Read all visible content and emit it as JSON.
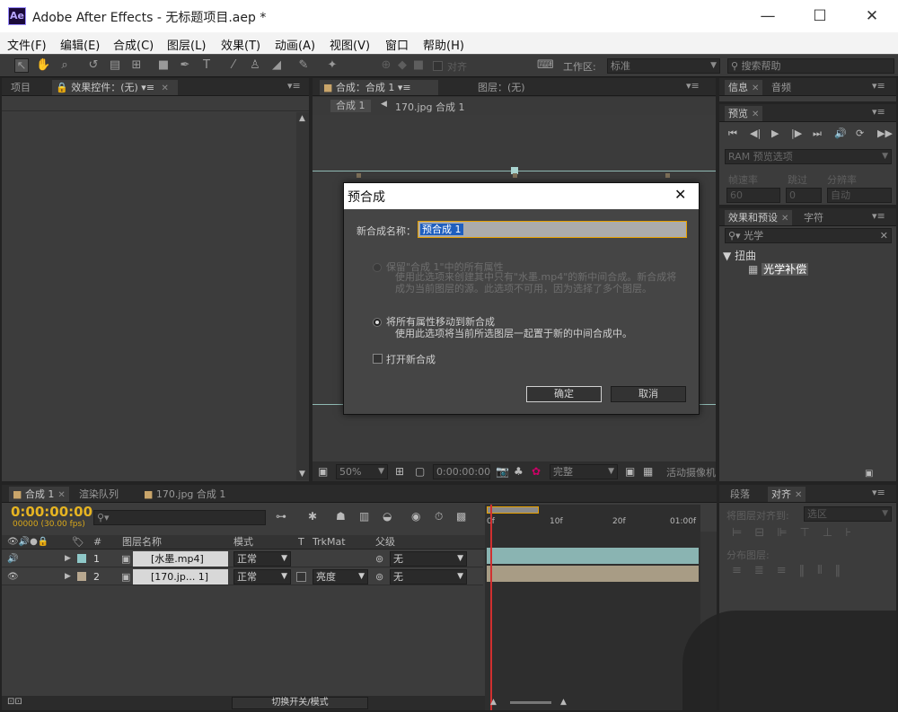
{
  "window": {
    "app_icon": "Ae",
    "title": "Adobe After Effects - 无标题项目.aep *",
    "minimize": "—",
    "maximize": "☐",
    "close": "✕"
  },
  "menu": [
    "文件(F)",
    "编辑(E)",
    "合成(C)",
    "图层(L)",
    "效果(T)",
    "动画(A)",
    "视图(V)",
    "窗口",
    "帮助(H)"
  ],
  "toolbar": {
    "align_label": "对齐",
    "workspace_label": "工作区:",
    "workspace_value": "标准",
    "search_placeholder": "搜索帮助"
  },
  "project_panel": {
    "tab_project": "项目",
    "tab_effect_controls": "效果控件：(无)"
  },
  "comp_panel": {
    "tab_comp": "合成：合成 1",
    "tab_layer": "图层：(无)",
    "breadcrumb_comp": "合成 1",
    "breadcrumb_item": "170.jpg 合成 1",
    "zoom": "50%",
    "timecode": "0:00:00:00",
    "resolution": "完整",
    "active_camera": "活动摄像机"
  },
  "info_panel": {
    "tab_info": "信息",
    "tab_audio": "音频"
  },
  "preview_panel": {
    "tab": "预览",
    "ram_options": "RAM 预览选项",
    "frame_rate_label": "帧速率",
    "skip_label": "跳过",
    "resolution_label": "分辨率",
    "frame_rate_value": "60",
    "skip_value": "0",
    "resolution_value": "自动"
  },
  "effects_panel": {
    "tab_effects": "效果和预设",
    "tab_char": "字符",
    "search_value": "光学",
    "category": "扭曲",
    "effect": "光学补偿"
  },
  "timeline": {
    "tab_comp": "合成 1",
    "tab_render": "渲染队列",
    "tab_jpg": "170.jpg 合成 1",
    "timecode": "0:00:00:00",
    "fps": "00000 (30.00 fps)",
    "col_num": "#",
    "col_name": "图层名称",
    "col_mode": "模式",
    "col_t": "T",
    "col_trkmat": "TrkMat",
    "col_parent": "父级",
    "ruler": [
      "0f",
      "10f",
      "20f",
      "01:00f"
    ],
    "layers": [
      {
        "num": "1",
        "name": "[水墨.mp4]",
        "mode": "正常",
        "trkmat": "",
        "parent": "无",
        "color": "#8fc8c8"
      },
      {
        "num": "2",
        "name": "[170.jp... 1]",
        "mode": "正常",
        "trkmat": "亮度",
        "parent": "无",
        "color": "#b8a890"
      }
    ],
    "toggle_switch": "切换开关/模式"
  },
  "align_panel": {
    "tab_paragraph": "段落",
    "tab_align": "对齐",
    "align_to_label": "将图层对齐到:",
    "align_to_value": "选区",
    "distribute_label": "分布图层:"
  },
  "dialog": {
    "title": "预合成",
    "name_label": "新合成名称：",
    "name_value": "预合成 1",
    "option1_title": "保留\"合成 1\"中的所有属性",
    "option1_desc": "使用此选项来创建其中只有\"水墨.mp4\"的新中间合成。新合成将成为当前图层的源。此选项不可用，因为选择了多个图层。",
    "option2_title": "将所有属性移动到新合成",
    "option2_desc": "使用此选项将当前所选图层一起置于新的中间合成中。",
    "open_new": "打开新合成",
    "ok": "确定",
    "cancel": "取消"
  }
}
